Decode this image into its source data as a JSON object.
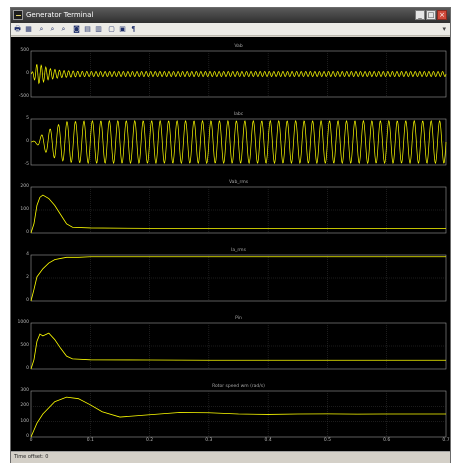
{
  "window": {
    "title": "Generator Terminal",
    "controls": [
      "minimize",
      "maximize",
      "close"
    ]
  },
  "toolbar": {
    "buttons": [
      {
        "name": "print",
        "icon": "printer-icon"
      },
      {
        "name": "parameters",
        "icon": "parameters-icon"
      },
      {
        "name": "zoom",
        "icon": "zoom-icon"
      },
      {
        "name": "zoom-x",
        "icon": "zoom-x-icon"
      },
      {
        "name": "zoom-y",
        "icon": "zoom-y-icon"
      },
      {
        "name": "autoscale",
        "icon": "binoculars-icon"
      },
      {
        "name": "save-axes",
        "icon": "save-axes-icon"
      },
      {
        "name": "restore-axes",
        "icon": "restore-axes-icon"
      },
      {
        "name": "floating-scope",
        "icon": "floating-scope-icon"
      },
      {
        "name": "signal-selection",
        "icon": "signal-selection-icon"
      },
      {
        "name": "legend",
        "icon": "legend-icon"
      }
    ]
  },
  "colors": {
    "plot_bg": "#000000",
    "axes_bg": "#000000",
    "grid": "#3a3a3a",
    "axis": "#9a9a9a",
    "trace": "#ffff00"
  },
  "status": {
    "text": "Time offset:  0"
  },
  "chart_data": [
    {
      "type": "line",
      "title": "Vab",
      "ylim": [
        -500,
        500
      ],
      "yticks": [
        -500,
        0,
        500
      ],
      "xlim": [
        0,
        0.7
      ],
      "grid": true,
      "series": [
        {
          "name": "",
          "x": [
            0,
            0.01,
            0.02,
            0.03,
            0.05,
            0.08,
            0.1,
            0.2,
            0.3,
            0.4,
            0.5,
            0.6,
            0.7
          ],
          "y": [
            0,
            220,
            180,
            120,
            80,
            60,
            55,
            55,
            55,
            55,
            55,
            55,
            55
          ]
        }
      ]
    },
    {
      "type": "line",
      "title": "Iabc",
      "ylim": [
        -5,
        5
      ],
      "yticks": [
        -5,
        0,
        5
      ],
      "xlim": [
        0,
        0.7
      ],
      "grid": true,
      "series": [
        {
          "name": "",
          "x": [
            0,
            0.01,
            0.02,
            0.04,
            0.06,
            0.1,
            0.2,
            0.3,
            0.4,
            0.5,
            0.6,
            0.7
          ],
          "y": [
            0,
            0.5,
            1.8,
            3.5,
            4.4,
            4.6,
            4.6,
            4.6,
            4.6,
            4.6,
            4.6,
            4.6
          ]
        }
      ]
    },
    {
      "type": "line",
      "title": "Vab_rms",
      "ylim": [
        0,
        200
      ],
      "yticks": [
        0,
        100,
        200
      ],
      "xlim": [
        0,
        0.7
      ],
      "grid": true,
      "series": [
        {
          "name": "",
          "x": [
            0,
            0.005,
            0.01,
            0.015,
            0.02,
            0.03,
            0.04,
            0.05,
            0.06,
            0.07,
            0.1,
            0.2,
            0.3,
            0.4,
            0.5,
            0.6,
            0.7
          ],
          "y": [
            0,
            40,
            120,
            155,
            165,
            150,
            120,
            80,
            40,
            25,
            22,
            20,
            20,
            20,
            20,
            20,
            20
          ]
        }
      ]
    },
    {
      "type": "line",
      "title": "Ia_rms",
      "ylim": [
        0,
        4
      ],
      "yticks": [
        0,
        2,
        4
      ],
      "xlim": [
        0,
        0.7
      ],
      "grid": true,
      "series": [
        {
          "name": "",
          "x": [
            0,
            0.005,
            0.01,
            0.02,
            0.03,
            0.04,
            0.05,
            0.06,
            0.08,
            0.1,
            0.2,
            0.3,
            0.4,
            0.5,
            0.6,
            0.7
          ],
          "y": [
            0,
            1.0,
            2.1,
            2.8,
            3.3,
            3.6,
            3.7,
            3.8,
            3.8,
            3.85,
            3.85,
            3.85,
            3.85,
            3.85,
            3.85,
            3.85
          ]
        }
      ]
    },
    {
      "type": "line",
      "title": "Pin",
      "ylim": [
        0,
        1000
      ],
      "yticks": [
        0,
        500,
        1000
      ],
      "xlim": [
        0,
        0.7
      ],
      "grid": true,
      "series": [
        {
          "name": "",
          "x": [
            0,
            0.005,
            0.01,
            0.015,
            0.02,
            0.03,
            0.04,
            0.05,
            0.06,
            0.07,
            0.1,
            0.2,
            0.3,
            0.4,
            0.5,
            0.6,
            0.7
          ],
          "y": [
            0,
            200,
            600,
            760,
            720,
            780,
            640,
            450,
            280,
            220,
            200,
            195,
            190,
            190,
            190,
            190,
            190
          ]
        }
      ]
    },
    {
      "type": "line",
      "title": "Rotor speed wm (rad/s)",
      "ylim": [
        0,
        300
      ],
      "yticks": [
        0,
        100,
        200,
        300
      ],
      "xlim": [
        0,
        0.7
      ],
      "xticks": [
        0,
        0.1,
        0.2,
        0.3,
        0.4,
        0.5,
        0.6,
        0.7
      ],
      "grid": true,
      "series": [
        {
          "name": "",
          "x": [
            0,
            0.01,
            0.02,
            0.04,
            0.06,
            0.08,
            0.1,
            0.12,
            0.15,
            0.2,
            0.25,
            0.3,
            0.35,
            0.4,
            0.45,
            0.5,
            0.55,
            0.6,
            0.65,
            0.7
          ],
          "y": [
            0,
            90,
            150,
            230,
            260,
            250,
            210,
            165,
            130,
            145,
            160,
            158,
            150,
            147,
            150,
            151,
            149,
            150,
            150,
            150
          ]
        }
      ]
    }
  ]
}
